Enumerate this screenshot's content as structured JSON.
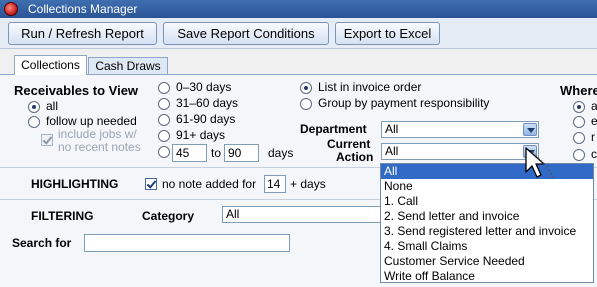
{
  "window": {
    "title": "Collections Manager"
  },
  "toolbar": {
    "run_refresh_label": "Run / Refresh Report",
    "save_conditions_label": "Save Report Conditions",
    "export_label": "Export to Excel"
  },
  "tabs": {
    "collections": "Collections",
    "cash_draws": "Cash Draws"
  },
  "receivables": {
    "heading": "Receivables to View",
    "opt_all": "all",
    "opt_follow_up": "follow up needed",
    "include_line1": "include jobs w/",
    "include_line2": "no recent notes"
  },
  "ages": {
    "opt_0_30": "0–30 days",
    "opt_31_60": "31–60 days",
    "opt_61_90": "61-90 days",
    "opt_91": "91+ days",
    "range_from": "45",
    "range_to_label": "to",
    "range_to": "90",
    "days_suffix": "days"
  },
  "order": {
    "opt_invoice": "List in invoice order",
    "opt_group": "Group by payment responsibility"
  },
  "department": {
    "label": "Department",
    "value": "All"
  },
  "current_action": {
    "label_line1": "Current",
    "label_line2": "Action",
    "value": "All"
  },
  "where": {
    "heading": "Where",
    "opt_a": "a",
    "opt_e": "e",
    "opt_r": "r",
    "opt_c": "c"
  },
  "highlighting": {
    "heading": "HIGHLIGHTING",
    "check_label": "no note added for",
    "days_value": "14",
    "days_suffix": "+ days"
  },
  "filtering": {
    "heading": "FILTERING",
    "category_label": "Category",
    "category_value": "All"
  },
  "search": {
    "label": "Search for",
    "value": ""
  },
  "dropdown_items": [
    "All",
    "None",
    "1. Call",
    "2. Send letter and invoice",
    "3. Send registered letter and invoice",
    "4. Small Claims",
    "Customer Service Needed",
    "Write off Balance"
  ]
}
